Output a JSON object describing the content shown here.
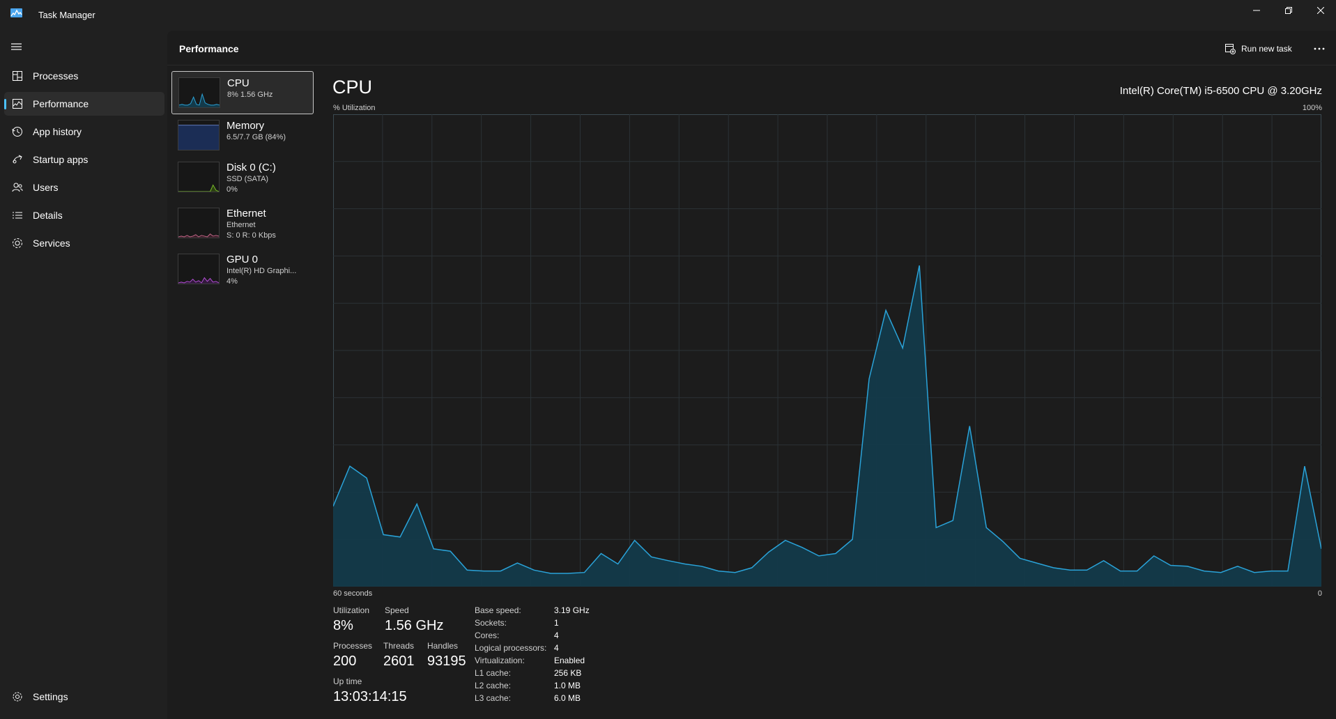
{
  "window": {
    "title": "Task Manager"
  },
  "sidebar": {
    "items": [
      {
        "label": "Processes",
        "icon": "processes-icon"
      },
      {
        "label": "Performance",
        "icon": "performance-icon",
        "active": true
      },
      {
        "label": "App history",
        "icon": "app-history-icon"
      },
      {
        "label": "Startup apps",
        "icon": "startup-apps-icon"
      },
      {
        "label": "Users",
        "icon": "users-icon"
      },
      {
        "label": "Details",
        "icon": "details-icon"
      },
      {
        "label": "Services",
        "icon": "services-icon"
      }
    ],
    "settings_label": "Settings"
  },
  "header": {
    "title": "Performance",
    "run_new_task": "Run new task"
  },
  "resources": [
    {
      "name": "CPU",
      "sub1": "8%  1.56 GHz",
      "sub2": "",
      "selected": true
    },
    {
      "name": "Memory",
      "sub1": "6.5/7.7 GB (84%)",
      "sub2": ""
    },
    {
      "name": "Disk 0 (C:)",
      "sub1": "SSD (SATA)",
      "sub2": "0%"
    },
    {
      "name": "Ethernet",
      "sub1": "Ethernet",
      "sub2": "S: 0 R: 0 Kbps"
    },
    {
      "name": "GPU 0",
      "sub1": "Intel(R) HD Graphi...",
      "sub2": "4%"
    }
  ],
  "cpu": {
    "title": "CPU",
    "model": "Intel(R) Core(TM) i5-6500 CPU @ 3.20GHz",
    "graph_label": "% Utilization",
    "graph_max": "100%",
    "axis_left": "60 seconds",
    "axis_right": "0",
    "stats": {
      "utilization_label": "Utilization",
      "utilization": "8%",
      "speed_label": "Speed",
      "speed": "1.56 GHz",
      "processes_label": "Processes",
      "processes": "200",
      "threads_label": "Threads",
      "threads": "2601",
      "handles_label": "Handles",
      "handles": "93195",
      "uptime_label": "Up time",
      "uptime": "13:03:14:15"
    },
    "specs": [
      {
        "key": "Base speed:",
        "value": "3.19 GHz"
      },
      {
        "key": "Sockets:",
        "value": "1"
      },
      {
        "key": "Cores:",
        "value": "4"
      },
      {
        "key": "Logical processors:",
        "value": "4"
      },
      {
        "key": "Virtualization:",
        "value": "Enabled"
      },
      {
        "key": "L1 cache:",
        "value": "256 KB"
      },
      {
        "key": "L2 cache:",
        "value": "1.0 MB"
      },
      {
        "key": "L3 cache:",
        "value": "6.0 MB"
      }
    ]
  },
  "chart_data": {
    "type": "area",
    "ylim": [
      0,
      100
    ],
    "xlim": [
      60,
      0
    ],
    "grid": true,
    "series": [
      {
        "values": [
          17,
          25.5,
          23,
          11,
          10.5,
          17.5,
          8,
          7.5,
          3.5,
          3.3,
          3.3,
          5,
          3.5,
          2.8,
          2.8,
          3,
          7,
          4.8,
          9.8,
          6.3,
          5.5,
          4.8,
          4.3,
          3.3,
          3,
          4,
          7.3,
          9.8,
          8.3,
          6.5,
          7,
          10,
          44,
          58.5,
          50.5,
          68,
          12.5,
          14,
          34,
          12.5,
          9.5,
          6,
          5,
          4,
          3.5,
          3.5,
          5.5,
          3.3,
          3.3,
          6.5,
          4.5,
          4.3,
          3.3,
          3,
          4.3,
          3,
          3.3,
          3.3,
          25.5,
          8
        ]
      }
    ],
    "colors": {
      "line": "#2aa3d9",
      "fill": "#133a4a",
      "grid": "#2b3236"
    }
  },
  "thumbnails": {
    "cpu": [
      3,
      4,
      3,
      3,
      5,
      14,
      4,
      3,
      18,
      6,
      4,
      3,
      3,
      4,
      3
    ],
    "disk": [
      0,
      0,
      0,
      0,
      0,
      0,
      0,
      0,
      0,
      0,
      0,
      0,
      9,
      2,
      0
    ],
    "ethernet": [
      1,
      2,
      1,
      3,
      1,
      2,
      4,
      1,
      3,
      2,
      1,
      5,
      2,
      3,
      2
    ],
    "gpu": [
      1,
      2,
      1,
      3,
      2,
      6,
      2,
      4,
      1,
      8,
      3,
      7,
      2,
      3,
      1
    ]
  }
}
